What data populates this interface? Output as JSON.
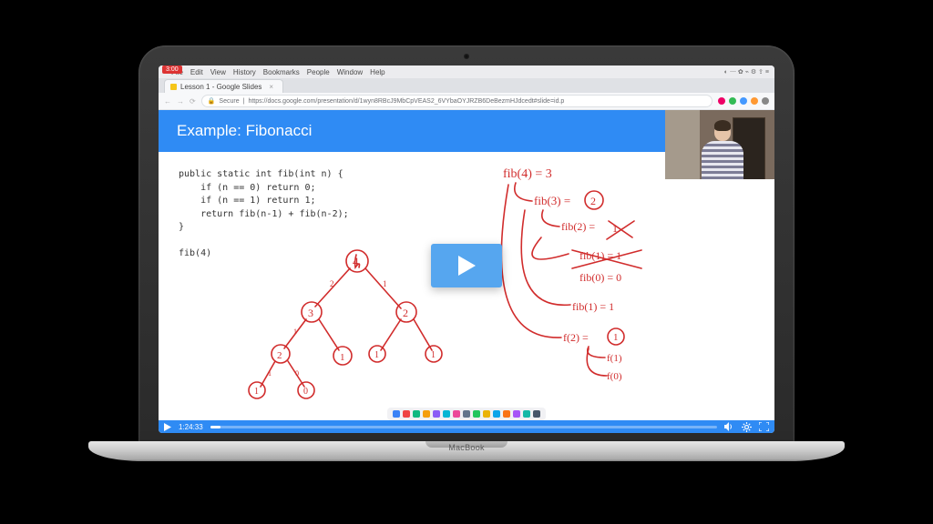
{
  "mac": {
    "rec_time": "3:00",
    "menus": [
      "File",
      "Edit",
      "View",
      "History",
      "Bookmarks",
      "People",
      "Window",
      "Help"
    ],
    "right_status": "◐ ⋯ ✿ ⌁ ⚙ ⇪ ≡"
  },
  "browser": {
    "tab_title": "Lesson 1 - Google Slides",
    "url_secure_label": "Secure",
    "url": "https://docs.google.com/presentation/d/1wyn8RBcJ9MbCpVEAS2_6VYbaOYJRZB6DeBezmHJdcedt#slide=id.p"
  },
  "slide": {
    "title": "Example: Fibonacci",
    "code": "public static int fib(int n) {\n    if (n == 0) return 0;\n    if (n == 1) return 1;\n    return fib(n-1) + fib(n-2);\n}\n\nfib(4)"
  },
  "annotations": {
    "lines": [
      "fib(4) = 3",
      "fib(3) = 2",
      "fib(2) = 1",
      "fib(1) = 1",
      "fib(0) = 0",
      "fib(1) = 1",
      "f(2) = 1",
      "f(1)",
      "f(0)"
    ],
    "tree_root": 4,
    "tree_children": {
      "4": [
        3,
        2
      ],
      "3": [
        2,
        1
      ],
      "2": [
        1,
        0
      ],
      "1": [],
      "0": []
    },
    "ink_color": "#d12c2c"
  },
  "player": {
    "timestamp": "1:24:33",
    "progress_pct": 2
  },
  "device": {
    "brand": "MacBook"
  }
}
